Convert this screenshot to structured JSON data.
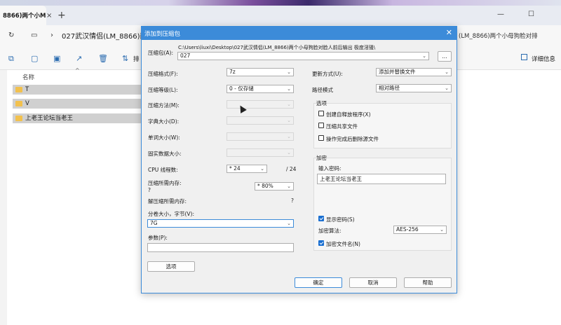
{
  "explorer": {
    "tab_title": "8866)两个小M",
    "tab_close": "×",
    "tab_add": "+",
    "address_path": "027武汉情侣(LM_8866)两个",
    "address_path_right": "(LM_8866)两个小母狗脸对排",
    "toolbar_sort_label": "排",
    "details_label": "详细信息",
    "column_name": "名称",
    "files": [
      {
        "name": "T"
      },
      {
        "name": "V"
      },
      {
        "name": "上老王论坛当老王"
      }
    ]
  },
  "dialog": {
    "title": "添加到压缩包",
    "archive_label": "压缩包(A):",
    "archive_path": "C:\\Users\\liuxi\\Desktop\\027武汉情侣(LM_8866)两个小母狗脸对脸人前后输出 极度淫骚\\",
    "archive_name": "027",
    "browse_label": "...",
    "format_label": "压缩格式(F):",
    "format_value": "7z",
    "level_label": "压缩等级(L):",
    "level_value": "0 - 仅存储",
    "method_label": "压缩方法(M):",
    "dict_label": "字典大小(D):",
    "word_label": "单词大小(W):",
    "solid_label": "固实数据大小:",
    "threads_label": "CPU 线程数:",
    "threads_value": "* 24",
    "threads_total": "/ 24",
    "mem_compress_label": "压缩所需内存:",
    "mem_compress_value": "?",
    "mem_percent": "* 80%",
    "mem_decompress_label": "解压缩所需内存:",
    "mem_decompress_value": "?",
    "split_label": "分卷大小，字节(V):",
    "split_value": "7G",
    "params_label": "参数(P):",
    "params_value": "",
    "options_button": "选项",
    "update_label": "更新方式(U):",
    "update_value": "添加并替换文件",
    "path_mode_label": "路径模式",
    "path_mode_value": "相对路径",
    "options_group": "选项",
    "opt_sfx": "创建自释放程序(X)",
    "opt_shared": "压缩共享文件",
    "opt_delete": "操作完成后删除源文件",
    "encrypt_group": "加密",
    "password_label": "输入密码:",
    "password_value": "上老王论坛当老王",
    "show_password": "显示密码(S)",
    "encrypt_method_label": "加密算法:",
    "encrypt_method_value": "AES-256",
    "encrypt_names": "加密文件名(N)",
    "ok": "确定",
    "cancel": "取消",
    "help": "帮助"
  },
  "colors": {
    "accent": "#3c8bd9",
    "checkbox": "#1a6fd1",
    "folder": "#f2c14e"
  }
}
